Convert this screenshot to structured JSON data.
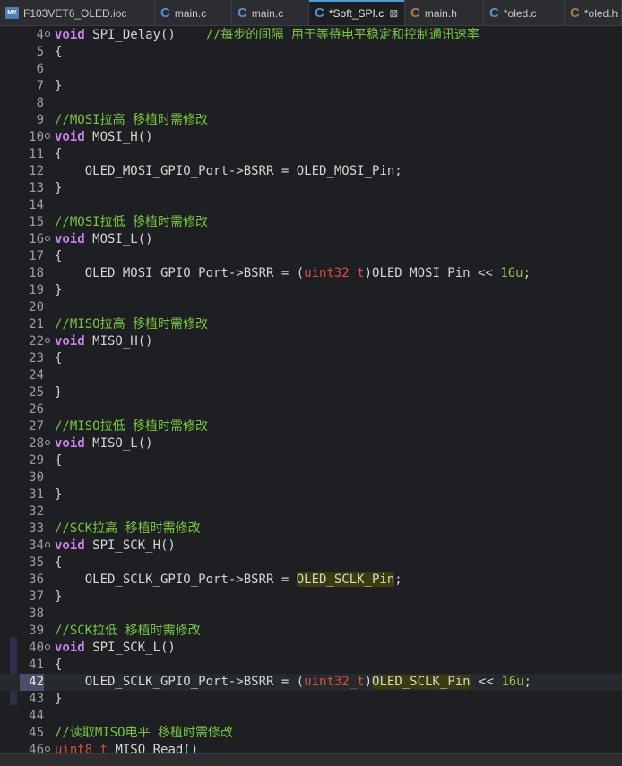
{
  "tabs": [
    {
      "icon": "mx-icon",
      "label": "F103VET6_OLED.ioc",
      "active": false,
      "close": false
    },
    {
      "icon": "c-file-icon",
      "label": "main.c",
      "active": false,
      "close": false
    },
    {
      "icon": "c-file-icon",
      "label": "main.c",
      "active": false,
      "close": false
    },
    {
      "icon": "c-file-icon",
      "label": "*Soft_SPI.c",
      "active": true,
      "close": true
    },
    {
      "icon": "h-file-icon",
      "label": "main.h",
      "active": false,
      "close": false
    },
    {
      "icon": "c-file-icon",
      "label": "*oled.c",
      "active": false,
      "close": false
    },
    {
      "icon": "h-file-icon",
      "label": "*oled.h",
      "active": false,
      "close": false
    }
  ],
  "icon_glyphs": {
    "mx": "MX",
    "c": "C",
    "h": "C",
    "close": "⊠"
  },
  "colors": {
    "keyword": "#cc7ff0",
    "comment": "#77c73d",
    "number": "#8dc43f",
    "type": "#d6513a",
    "highlight": "#3b3b0c",
    "current_line": "#262a2f",
    "tab_accent": "#4b9bd6"
  },
  "editor": {
    "current_line": 42,
    "lines": [
      {
        "n": "4",
        "fold": true,
        "t": [
          {
            "c": "kw",
            "s": "void"
          },
          {
            "s": " SPI_Delay()    "
          },
          {
            "c": "cmt",
            "s": "//每步的间隔 用于等待电平稳定和控制通讯速率"
          }
        ]
      },
      {
        "n": "5",
        "t": [
          {
            "s": "{"
          }
        ]
      },
      {
        "n": "6",
        "t": []
      },
      {
        "n": "7",
        "t": [
          {
            "s": "}"
          }
        ]
      },
      {
        "n": "8",
        "t": []
      },
      {
        "n": "9",
        "t": [
          {
            "c": "cmt",
            "s": "//MOSI拉高 移植时需修改"
          }
        ]
      },
      {
        "n": "10",
        "fold": true,
        "t": [
          {
            "c": "kw",
            "s": "void"
          },
          {
            "s": " MOSI_H()"
          }
        ]
      },
      {
        "n": "11",
        "t": [
          {
            "s": "{"
          }
        ]
      },
      {
        "n": "12",
        "t": [
          {
            "s": "    OLED_MOSI_GPIO_Port->BSRR = OLED_MOSI_Pin;"
          }
        ]
      },
      {
        "n": "13",
        "t": [
          {
            "s": "}"
          }
        ]
      },
      {
        "n": "14",
        "t": []
      },
      {
        "n": "15",
        "t": [
          {
            "c": "cmt",
            "s": "//MOSI拉低 移植时需修改"
          }
        ]
      },
      {
        "n": "16",
        "fold": true,
        "t": [
          {
            "c": "kw",
            "s": "void"
          },
          {
            "s": " MOSI_L()"
          }
        ]
      },
      {
        "n": "17",
        "t": [
          {
            "s": "{"
          }
        ]
      },
      {
        "n": "18",
        "t": [
          {
            "s": "    OLED_MOSI_GPIO_Port->BSRR = ("
          },
          {
            "c": "ty",
            "s": "uint32_t"
          },
          {
            "s": ")OLED_MOSI_Pin << "
          },
          {
            "c": "num",
            "s": "16u"
          },
          {
            "s": ";"
          }
        ]
      },
      {
        "n": "19",
        "t": [
          {
            "s": "}"
          }
        ]
      },
      {
        "n": "20",
        "t": []
      },
      {
        "n": "21",
        "t": [
          {
            "c": "cmt",
            "s": "//MISO拉高 移植时需修改"
          }
        ]
      },
      {
        "n": "22",
        "fold": true,
        "t": [
          {
            "c": "kw",
            "s": "void"
          },
          {
            "s": " MISO_H()"
          }
        ]
      },
      {
        "n": "23",
        "t": [
          {
            "s": "{"
          }
        ]
      },
      {
        "n": "24",
        "t": []
      },
      {
        "n": "25",
        "t": [
          {
            "s": "}"
          }
        ]
      },
      {
        "n": "26",
        "t": []
      },
      {
        "n": "27",
        "t": [
          {
            "c": "cmt",
            "s": "//MISO拉低 移植时需修改"
          }
        ]
      },
      {
        "n": "28",
        "fold": true,
        "t": [
          {
            "c": "kw",
            "s": "void"
          },
          {
            "s": " MISO_L()"
          }
        ]
      },
      {
        "n": "29",
        "t": [
          {
            "s": "{"
          }
        ]
      },
      {
        "n": "30",
        "t": []
      },
      {
        "n": "31",
        "t": [
          {
            "s": "}"
          }
        ]
      },
      {
        "n": "32",
        "t": []
      },
      {
        "n": "33",
        "t": [
          {
            "c": "cmt",
            "s": "//SCK拉高 移植时需修改"
          }
        ]
      },
      {
        "n": "34",
        "fold": true,
        "t": [
          {
            "c": "kw",
            "s": "void"
          },
          {
            "s": " SPI_SCK_H()"
          }
        ]
      },
      {
        "n": "35",
        "t": [
          {
            "s": "{"
          }
        ]
      },
      {
        "n": "36",
        "t": [
          {
            "s": "    OLED_SCLK_GPIO_Port->BSRR = "
          },
          {
            "c": "hl",
            "s": "OLED_SCLK_Pin"
          },
          {
            "s": ";"
          }
        ]
      },
      {
        "n": "37",
        "t": [
          {
            "s": "}"
          }
        ]
      },
      {
        "n": "38",
        "t": []
      },
      {
        "n": "39",
        "t": [
          {
            "c": "cmt",
            "s": "//SCK拉低 移植时需修改"
          }
        ]
      },
      {
        "n": "40",
        "fold": true,
        "t": [
          {
            "c": "kw",
            "s": "void"
          },
          {
            "s": " SPI_SCK_L()"
          }
        ]
      },
      {
        "n": "41",
        "t": [
          {
            "s": "{"
          }
        ]
      },
      {
        "n": "42",
        "t": [
          {
            "s": "    OLED_SCLK_GPIO_Port->BSRR = ("
          },
          {
            "c": "ty",
            "s": "uint32_t"
          },
          {
            "s": ")"
          },
          {
            "c": "hl",
            "s": "OLED_SCLK_Pin",
            "caret": true
          },
          {
            "s": " << "
          },
          {
            "c": "num",
            "s": "16u"
          },
          {
            "s": ";"
          }
        ]
      },
      {
        "n": "43",
        "t": [
          {
            "s": "}"
          }
        ]
      },
      {
        "n": "44",
        "t": []
      },
      {
        "n": "45",
        "t": [
          {
            "c": "cmt",
            "s": "//读取MISO电平 移植时需修改"
          }
        ]
      },
      {
        "n": "46",
        "fold": true,
        "t": [
          {
            "c": "ty",
            "s": "uint8_t"
          },
          {
            "s": " MISO_Read()"
          }
        ]
      }
    ]
  }
}
